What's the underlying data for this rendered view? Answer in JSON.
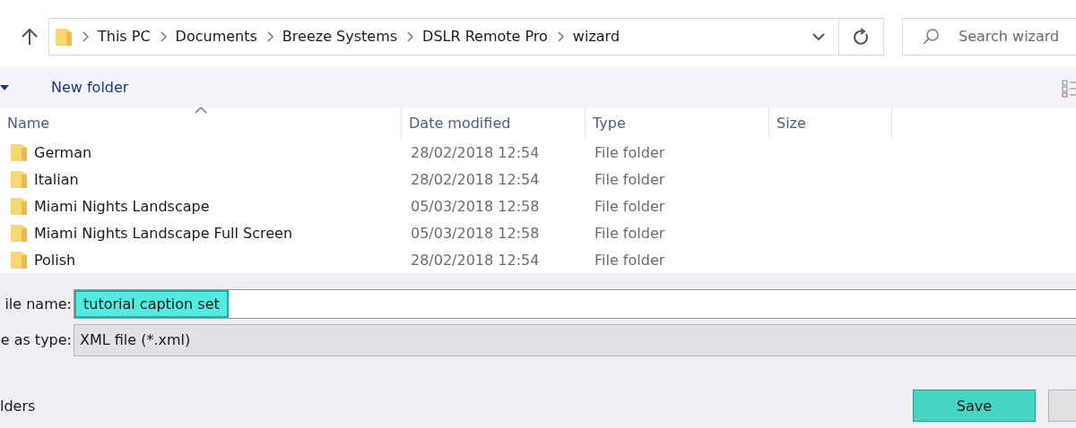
{
  "breadcrumb": [
    "This PC",
    "Documents",
    "Breeze Systems",
    "DSLR Remote Pro",
    "wizard"
  ],
  "search": {
    "placeholder": "Search wizard"
  },
  "toolbar": {
    "new_folder": "New folder"
  },
  "columns": [
    {
      "label": "Name",
      "sorted": true
    },
    {
      "label": "Date modified",
      "sorted": false
    },
    {
      "label": "Type",
      "sorted": false
    },
    {
      "label": "Size",
      "sorted": false
    }
  ],
  "rows": [
    {
      "name": "German",
      "date": "28/02/2018 12:54",
      "type": "File folder"
    },
    {
      "name": "Italian",
      "date": "28/02/2018 12:54",
      "type": "File folder"
    },
    {
      "name": "Miami Nights Landscape",
      "date": "05/03/2018 12:58",
      "type": "File folder"
    },
    {
      "name": "Miami Nights Landscape Full Screen",
      "date": "05/03/2018 12:58",
      "type": "File folder"
    },
    {
      "name": "Polish",
      "date": "28/02/2018 12:54",
      "type": "File folder"
    }
  ],
  "file_name": {
    "label": "ile name:",
    "value": "tutorial caption set",
    "text_selected": true
  },
  "file_type": {
    "label": "e as type:",
    "value": "XML file (*.xml)"
  },
  "hide_folders": "lders",
  "save_button": {
    "label": "Save",
    "highlighted": true
  }
}
